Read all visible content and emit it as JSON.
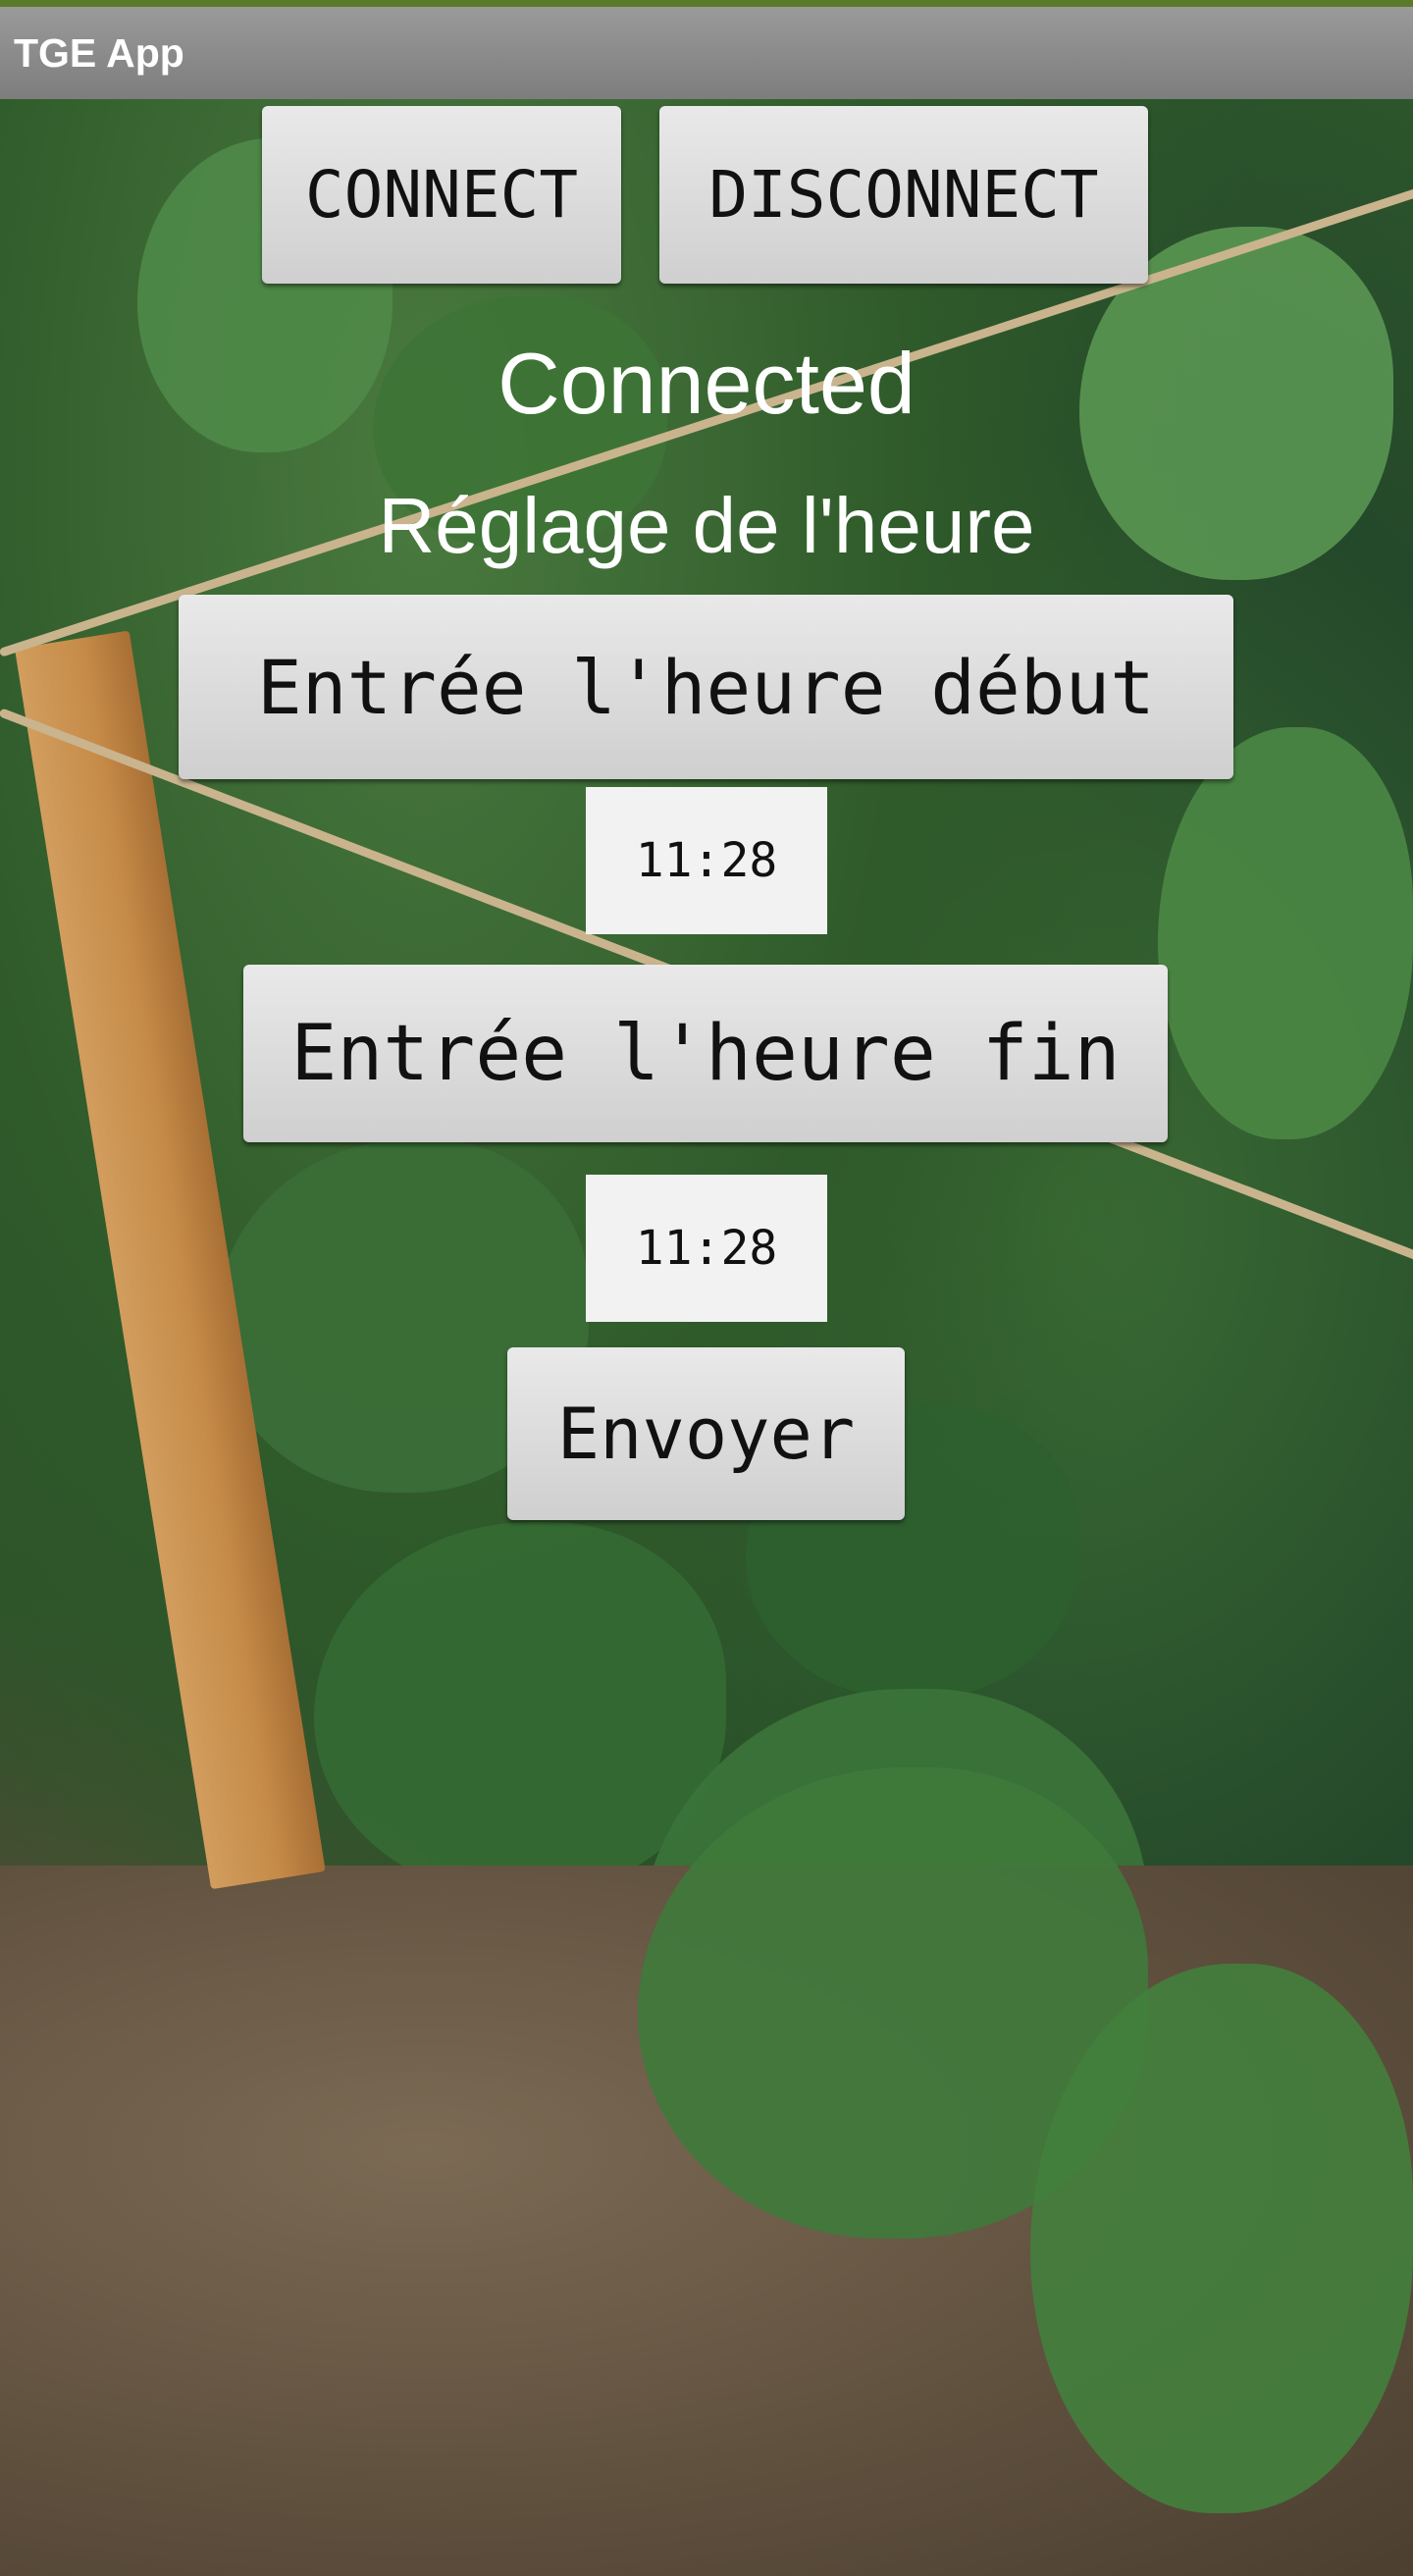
{
  "app": {
    "title": "TGE App"
  },
  "controls": {
    "connect_label": "CONNECT",
    "disconnect_label": "DISCONNECT",
    "status_text": "Connected",
    "section_title": "Réglage de l'heure",
    "start_time_button_label": "Entrée l'heure début",
    "start_time_value": "11:28",
    "end_time_button_label": "Entrée l'heure fin",
    "end_time_value": "11:28",
    "send_label": "Envoyer"
  },
  "colors": {
    "titlebar": "#8a8a8a",
    "accent": "#5a7a2a",
    "button": "#dcdcdc",
    "label_text": "#ffffff"
  }
}
